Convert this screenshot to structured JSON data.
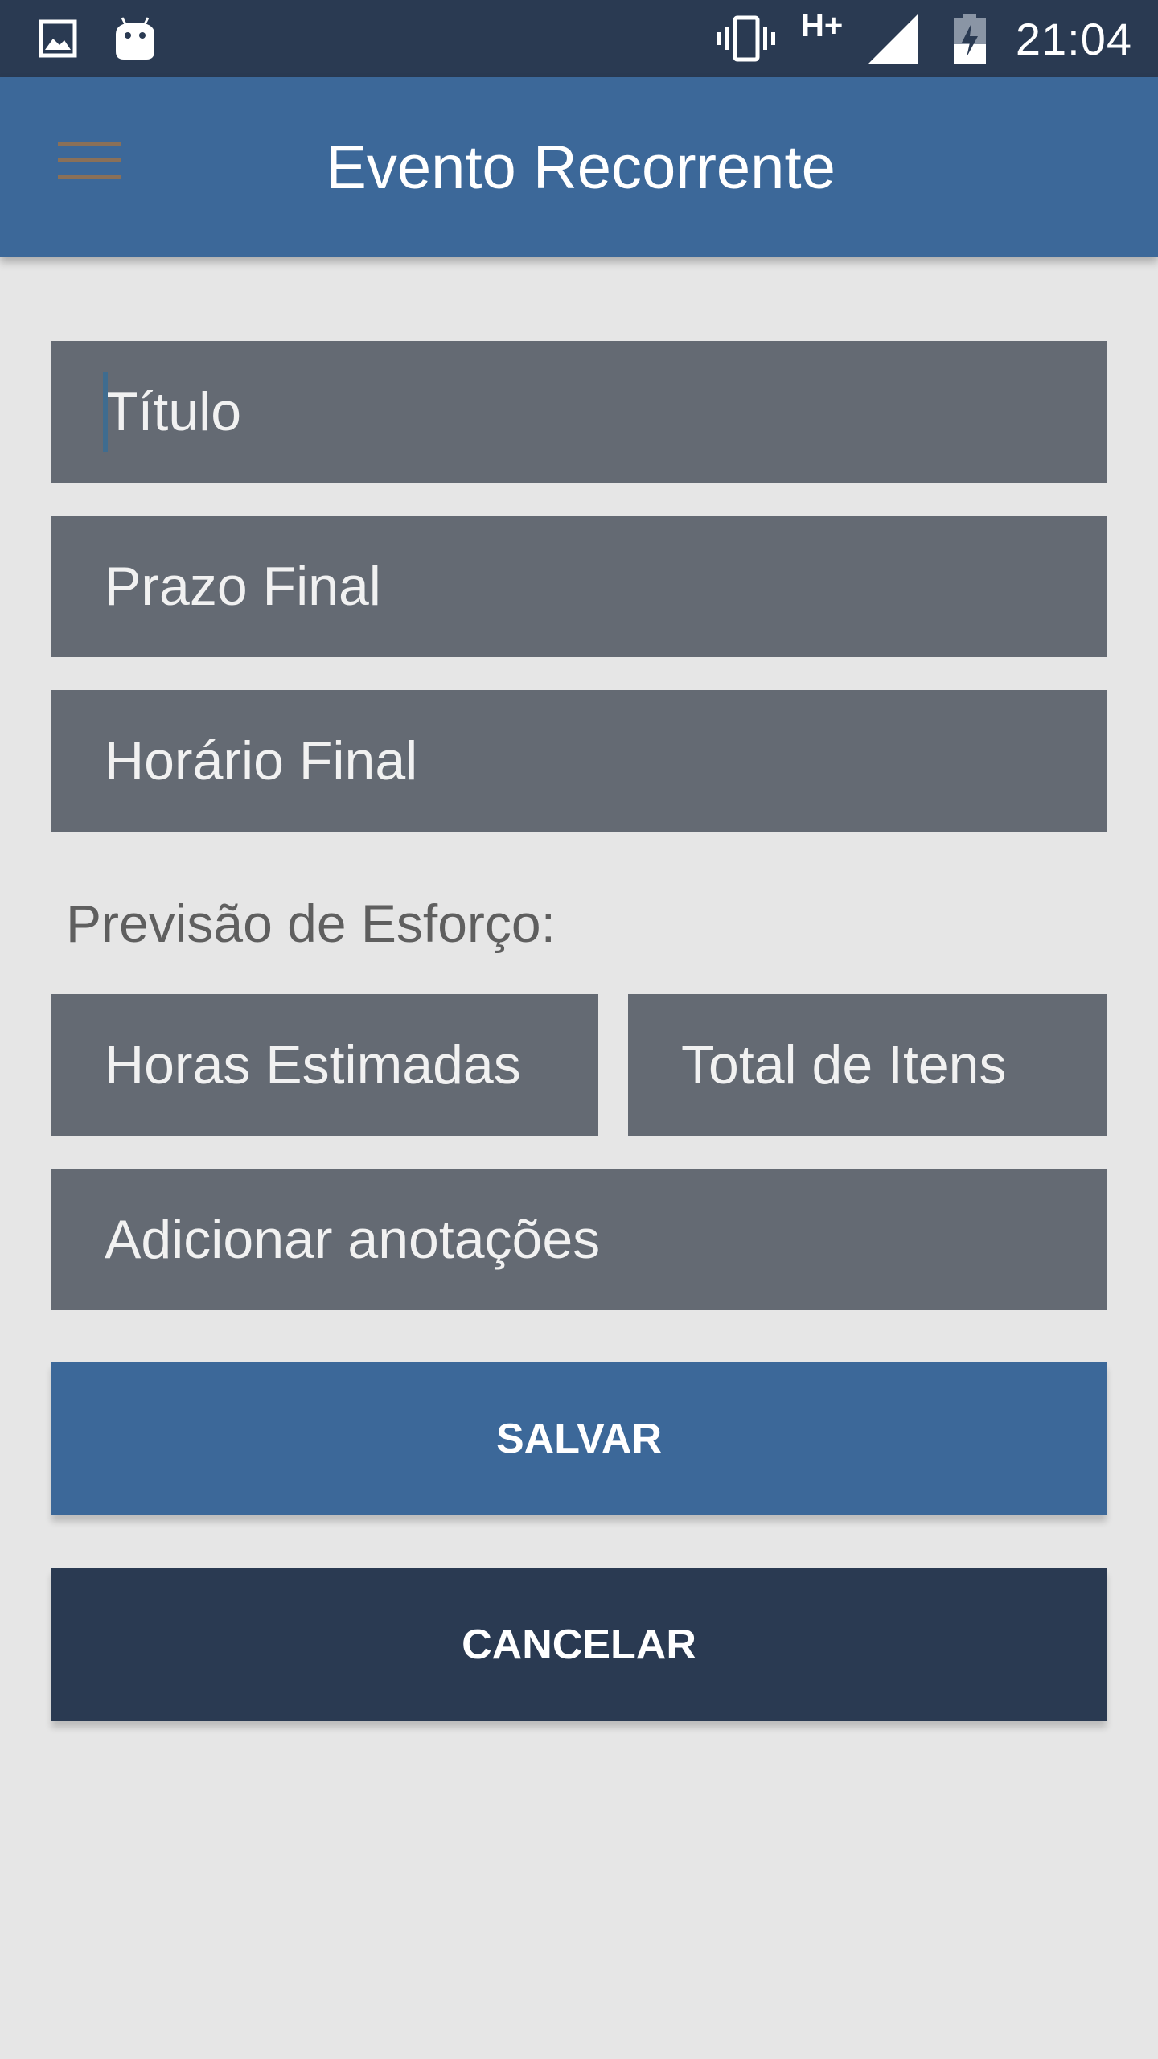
{
  "status_bar": {
    "time": "21:04",
    "network": "H+",
    "icons": [
      "image-icon",
      "android-icon",
      "vibrate-icon",
      "signal-icon",
      "battery-charging-icon"
    ]
  },
  "app_bar": {
    "title": "Evento Recorrente",
    "menu_icon": "hamburger-menu-icon"
  },
  "form": {
    "title_placeholder": "Título",
    "deadline_placeholder": "Prazo Final",
    "end_time_placeholder": "Horário Final",
    "effort_label": "Previsão de Esforço:",
    "estimated_hours_placeholder": "Horas Estimadas",
    "total_items_placeholder": "Total de Itens",
    "notes_placeholder": "Adicionar anotações"
  },
  "actions": {
    "save_label": "SALVAR",
    "cancel_label": "CANCELAR"
  },
  "colors": {
    "status_bar": "#2a3a52",
    "app_bar": "#3c6899",
    "field_bg": "#646a73",
    "background": "#e6e6e6",
    "save_button": "#3c6899",
    "cancel_button": "#2a3a52"
  }
}
